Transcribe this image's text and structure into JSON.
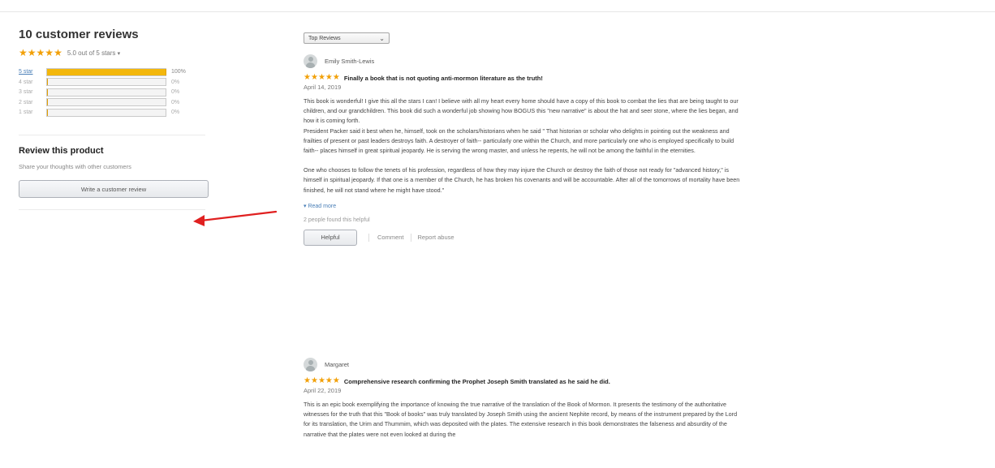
{
  "summary": {
    "title": "10 customer reviews",
    "rating_text": "5.0 out of 5 stars",
    "rating_value": 5,
    "caret": "▾"
  },
  "histogram": [
    {
      "label": "5 star",
      "percent_text": "100%",
      "percent": 100,
      "active": true
    },
    {
      "label": "4 star",
      "percent_text": "0%",
      "percent": 0,
      "active": false
    },
    {
      "label": "3 star",
      "percent_text": "0%",
      "percent": 0,
      "active": false
    },
    {
      "label": "2 star",
      "percent_text": "0%",
      "percent": 0,
      "active": false
    },
    {
      "label": "1 star",
      "percent_text": "0%",
      "percent": 0,
      "active": false
    }
  ],
  "review_product": {
    "heading": "Review this product",
    "subtext": "Share your thoughts with other customers",
    "button_label": "Write a customer review"
  },
  "sort": {
    "selected": "Top Reviews"
  },
  "reviews": [
    {
      "reviewer": "Emily Smith-Lewis",
      "stars": 5,
      "headline": "Finally a book that is not quoting anti-mormon literature as the truth!",
      "date": "April 14, 2019",
      "paragraphs": [
        "This book is wonderful! I give this all the stars I can! I believe with all my heart every home should have a copy of this book to combat the lies that are being taught to our children, and our grandchildren. This book did such a wonderful job showing how BOGUS this \"new narrative\" is about the hat and seer stone, where the lies began, and how it is coming forth.",
        "President Packer said it best when he, himself, took on the scholars/historians when he said \" That historian or scholar who delights in pointing out the weakness and frailties of present or past leaders destroys faith. A destroyer of faith-- particularly one within the Church, and more particularly one who is employed specifically to build faith-- places himself in great spiritual jeopardy. He is serving the wrong master, and unless he repents, he will not be among the faithful in the eternities.",
        "One who chooses to follow the tenets of his profession, regardless of how they may injure the Church or destroy the faith of those not ready for \"advanced history,\" is himself in spiritual jeopardy. If that one is a member of the Church, he has broken his covenants and will be accountable. After all of the tomorrows of mortality have been finished, he will not stand where he might have stood.\""
      ],
      "read_more": "▾ Read more",
      "helpful_count": "2 people found this helpful",
      "helpful_label": "Helpful",
      "comment_label": "Comment",
      "report_label": "Report abuse"
    },
    {
      "reviewer": "Margaret",
      "stars": 5,
      "headline": "Comprehensive research confirming the Prophet Joseph Smith translated as he said he did.",
      "date": "April 22, 2019",
      "paragraphs": [
        "This is an epic book exemplifying the importance of knowing the true narrative of the translation of the Book of Mormon. It presents the testimony of the authoritative witnesses for the truth that this \"Book of books\" was truly translated by Joseph Smith using the ancient Nephite record, by means of the instrument prepared by the Lord for its translation, the Urim and Thummim, which was deposited with the plates. The extensive research in this book demonstrates the falseness and absurdity of the narrative that the plates were not even looked at during the"
      ]
    }
  ],
  "colors": {
    "star": "#f2a007",
    "bar_fill": "#f3b70c",
    "link": "#4a7fb7",
    "arrow": "#e02020"
  },
  "icons": {
    "star": "★",
    "chevron": "⌄"
  }
}
